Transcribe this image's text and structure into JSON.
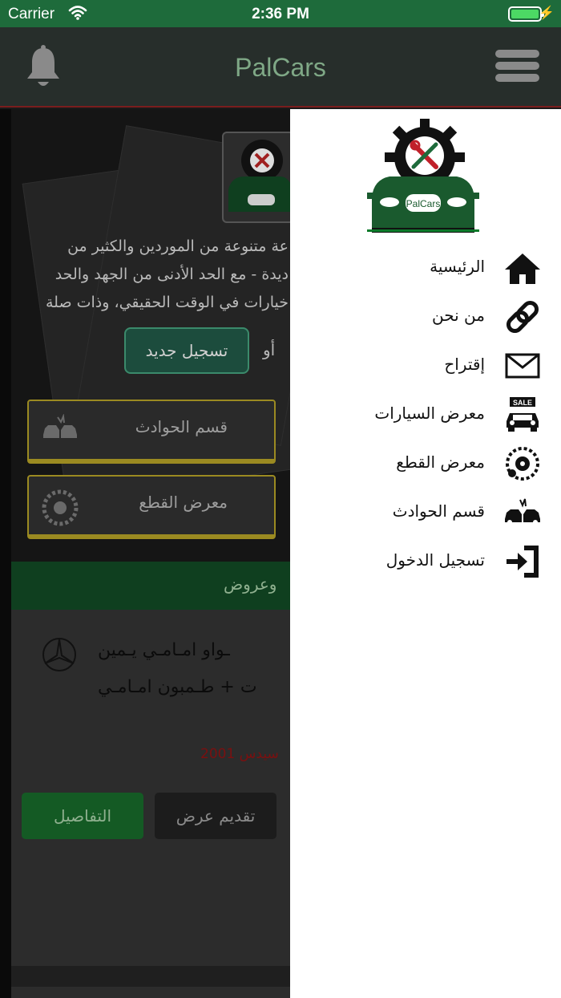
{
  "status_bar": {
    "carrier": "Carrier",
    "time": "2:36 PM"
  },
  "nav": {
    "title": "PalCars"
  },
  "background": {
    "hero_lines": [
      "عة متنوعة من الموردين والكثير من",
      "ديدة - مع الحد الأدنى من الجهد والحد",
      "خيارات في الوقت الحقيقي، وذات صلة"
    ],
    "register_label": "تسجيل جديد",
    "or_label": "أو",
    "tiles": [
      {
        "label": "قسم الحوادث",
        "icon": "car-crash-icon"
      },
      {
        "label": "معرض القطع",
        "icon": "car-parts-icon"
      }
    ],
    "offers_label": "وعروض",
    "card": {
      "title_line1": "ـواو امـامـي يـمين",
      "title_line2": "ت + طـمبون امـامـي",
      "meta": "سيدس 2001",
      "details_label": "التفاصيل",
      "offer_label": "تقديم عرض",
      "brand_icon": "mercedes-logo-icon"
    }
  },
  "drawer": {
    "logo_text": "PalCars",
    "items": [
      {
        "label": "الرئيسية",
        "icon": "home-icon"
      },
      {
        "label": "من نحن",
        "icon": "link-icon"
      },
      {
        "label": "إقتراح",
        "icon": "mail-icon"
      },
      {
        "label": "معرض السيارات",
        "icon": "car-sale-icon"
      },
      {
        "label": "معرض القطع",
        "icon": "car-parts-icon"
      },
      {
        "label": "قسم الحوادث",
        "icon": "car-crash-icon"
      },
      {
        "label": "تسجيل الدخول",
        "icon": "login-icon"
      }
    ]
  },
  "colors": {
    "status_bar": "#1e6b3b",
    "nav_bar": "#272e2b",
    "accent_green": "#1f7a3a",
    "tile_border": "#9b8a21"
  }
}
